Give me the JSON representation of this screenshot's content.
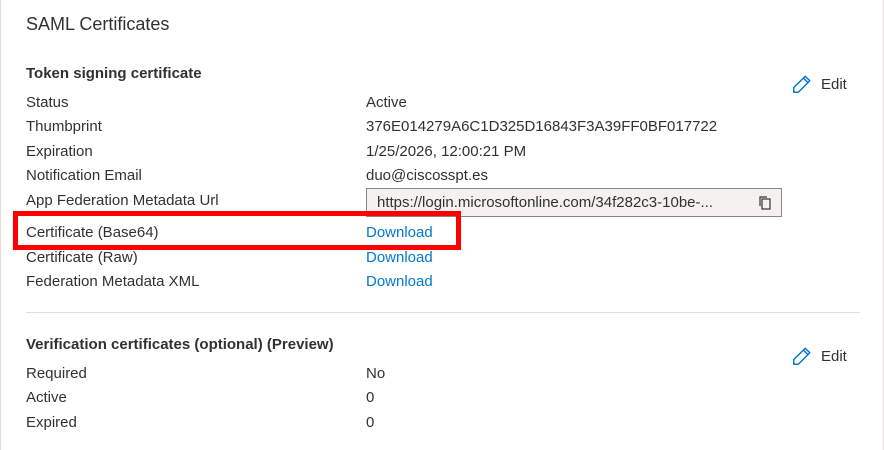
{
  "page": {
    "title": "SAML Certificates"
  },
  "token_signing": {
    "title": "Token signing certificate",
    "edit_label": "Edit",
    "rows": [
      {
        "label": "Status",
        "value": "Active"
      },
      {
        "label": "Thumbprint",
        "value": "376E014279A6C1D325D16843F3A39FF0BF017722"
      },
      {
        "label": "Expiration",
        "value": "1/25/2026, 12:00:21 PM"
      },
      {
        "label": "Notification Email",
        "value": "duo@ciscosspt.es"
      },
      {
        "label": "App Federation Metadata Url",
        "value": "https://login.microsoftonline.com/34f282c3-10be-..."
      },
      {
        "label": "Certificate (Base64)",
        "value": "Download"
      },
      {
        "label": "Certificate (Raw)",
        "value": "Download"
      },
      {
        "label": "Federation Metadata XML",
        "value": "Download"
      }
    ]
  },
  "verification": {
    "title": "Verification certificates (optional) (Preview)",
    "edit_label": "Edit",
    "rows": [
      {
        "label": "Required",
        "value": "No"
      },
      {
        "label": "Active",
        "value": "0"
      },
      {
        "label": "Expired",
        "value": "0"
      }
    ]
  },
  "colors": {
    "link": "#0078d4",
    "highlight": "#ff0000",
    "text": "#323130"
  },
  "icons": {
    "edit": "pencil-icon",
    "copy": "copy-icon"
  }
}
